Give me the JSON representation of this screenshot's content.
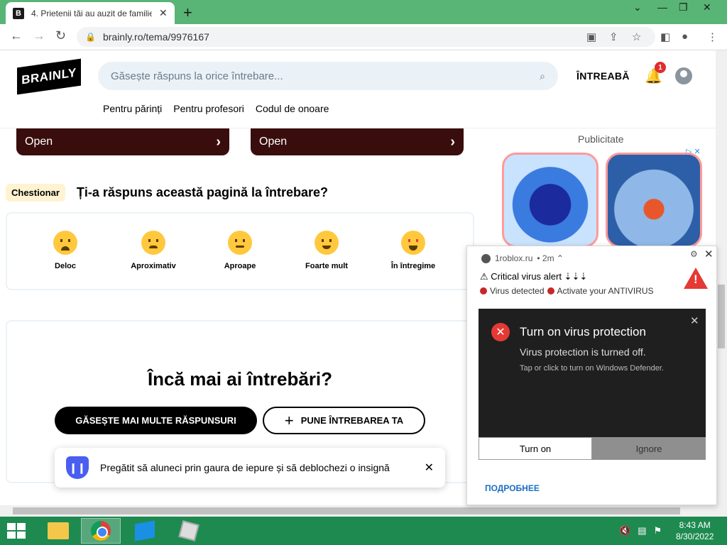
{
  "browser": {
    "tab_title": "4. Prietenii tăi au auzit de familie",
    "tab_favicon": "B",
    "url": "brainly.ro/tema/9976167"
  },
  "site": {
    "logo": "BRAINLY",
    "search_placeholder": "Găsește răspuns la orice întrebare...",
    "ask_label": "ÎNTREABĂ",
    "notifications_count": "1",
    "nav": [
      "Pentru părinți",
      "Pentru profesori",
      "Codul de onoare"
    ]
  },
  "promos": [
    {
      "label": "Open"
    },
    {
      "label": "Open"
    }
  ],
  "quiz": {
    "badge": "Chestionar",
    "question": "Ți-a răspuns această pagină la întrebare?",
    "options": [
      "Deloc",
      "Aproximativ",
      "Aproape",
      "Foarte mult",
      "În întregime"
    ]
  },
  "more": {
    "title": "Încă mai ai întrebări?",
    "find_button": "GĂSEȘTE MAI MULTE RĂSPUNSURI",
    "ask_button": "PUNE ÎNTREBAREA TA"
  },
  "toast": {
    "message": "Pregătit să aluneci prin gaura de iepure și să deblochezi o insignă"
  },
  "ad": {
    "label": "Publicitate"
  },
  "notification": {
    "source": "1roblox.ru",
    "time": "• 2m ⌃",
    "line1": "⚠ Critical virus alert ⇣⇣⇣",
    "status1": "Virus detected",
    "status2": "Activate your ANTIVIRUS",
    "card_title": "Turn on virus protection",
    "card_subtitle": "Virus protection is turned off.",
    "card_small": "Tap or click to turn on Windows Defender.",
    "turn_on": "Turn on",
    "ignore": "Ignore",
    "more_link": "ПОДРОБНЕЕ"
  },
  "taskbar": {
    "time": "8:43 AM",
    "date": "8/30/2022"
  },
  "colors": {
    "chrome_frame": "#59b575",
    "taskbar": "#1e8a50",
    "promo_bg": "#3a0d0d",
    "alert_red": "#e53935"
  }
}
